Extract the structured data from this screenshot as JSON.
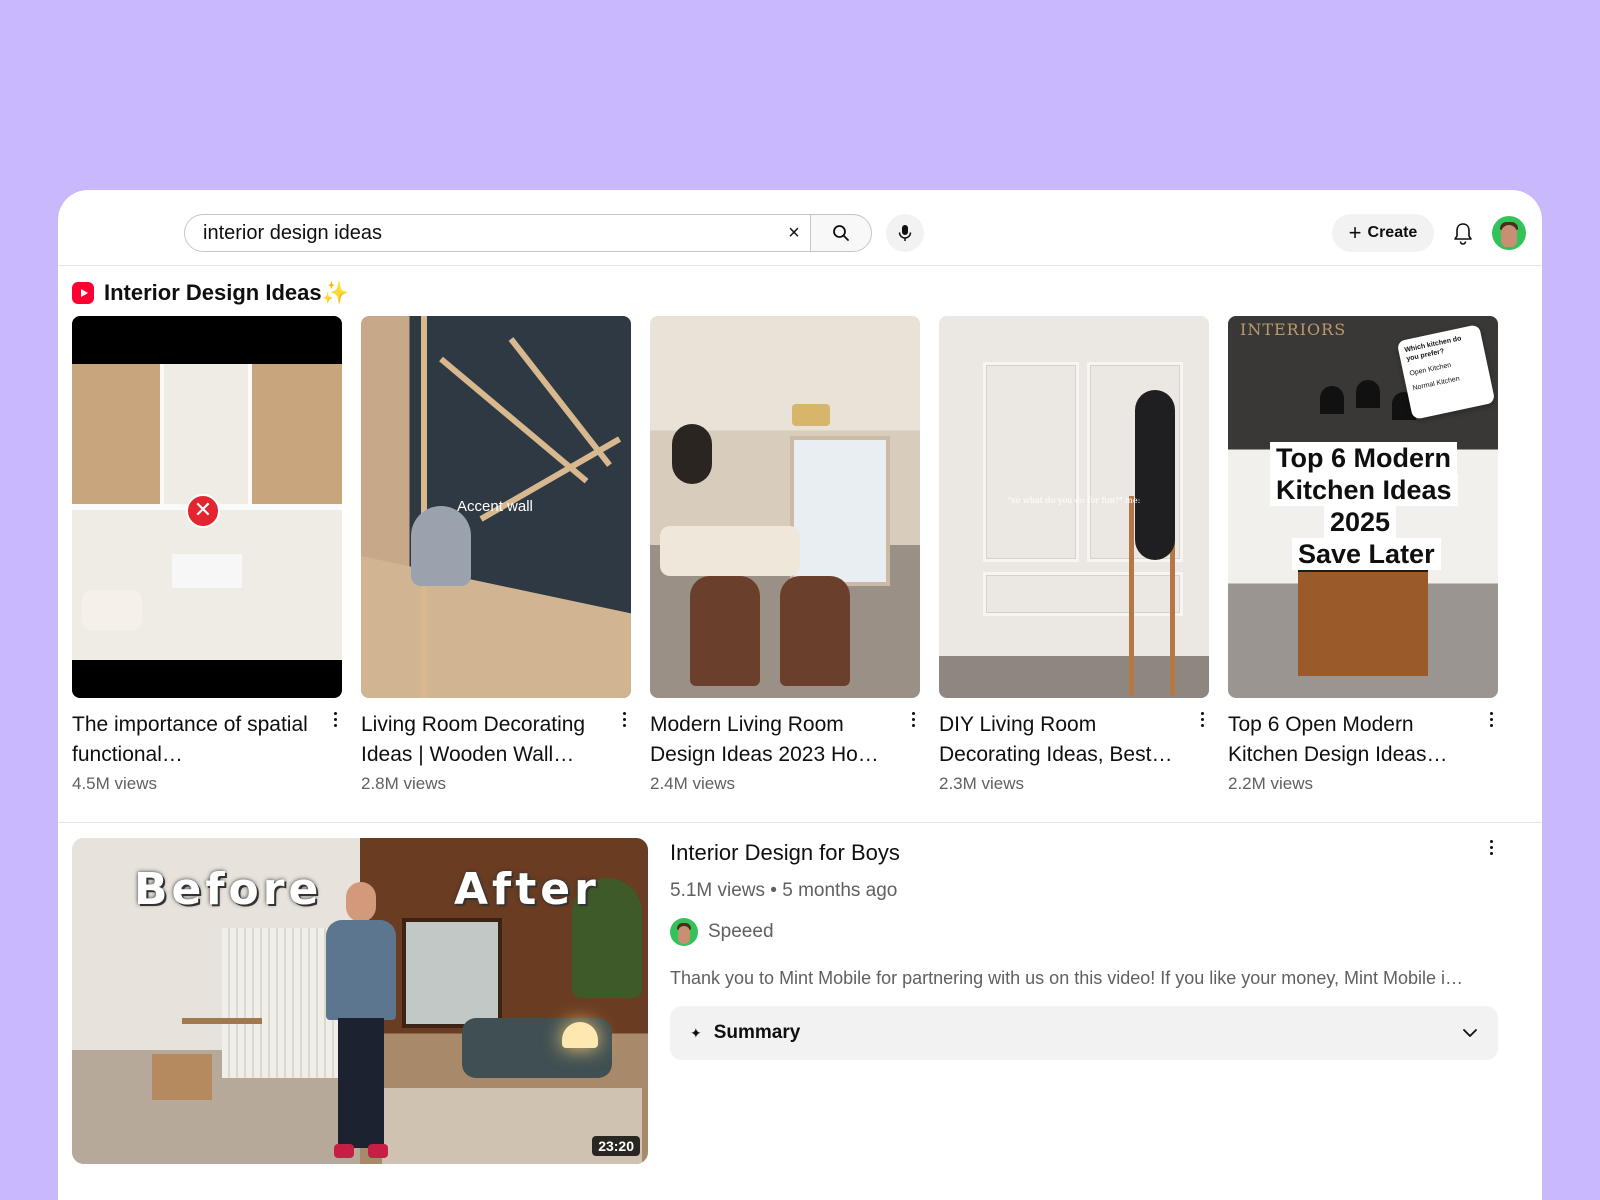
{
  "search": {
    "value": "interior design ideas",
    "clear_label": "×"
  },
  "header": {
    "create_label": "Create",
    "create_plus": "+"
  },
  "icons": {
    "search": "search-icon",
    "mic": "microphone-icon",
    "bell": "bell-icon",
    "avatar": "avatar"
  },
  "colors": {
    "background": "#c9b8fb",
    "shorts_logo": "#ff0033"
  },
  "shorts": {
    "section_title": "Interior Design Ideas",
    "sparkle": "✨",
    "items": [
      {
        "title": "The importance of spatial functional…",
        "views": "4.5M views"
      },
      {
        "title": "Living Room Decorating Ideas | Wooden Wall…",
        "views": "2.8M views",
        "thumb_label": "Accent wall"
      },
      {
        "title": "Modern Living Room Design Ideas 2023 Ho…",
        "views": "2.4M views"
      },
      {
        "title": "DIY Living Room Decorating Ideas, Best…",
        "views": "2.3M views",
        "thumb_caption": "\"so what do you do for fun?\" me:"
      },
      {
        "title": "Top 6 Open Modern Kitchen Design Ideas…",
        "views": "2.2M views",
        "thumb_brand": "INTERIORS",
        "thumb_note": [
          "Which kitchen do you prefer?",
          "Open Kitchen",
          "Normal Kitchen"
        ],
        "thumb_overlay": [
          "Top 6 Modern",
          "Kitchen Ideas",
          "2025",
          "Save Later"
        ]
      }
    ]
  },
  "video": {
    "title": "Interior Design for Boys",
    "meta": "5.1M views • 5 months ago",
    "channel": "Speeed",
    "description": "Thank you to Mint Mobile for partnering with us on this video! If you like your money, Mint Mobile i…",
    "duration": "23:20",
    "thumb_before": "Before",
    "thumb_after": "After",
    "summary_label": "Summary",
    "summary_icon": "✦"
  }
}
